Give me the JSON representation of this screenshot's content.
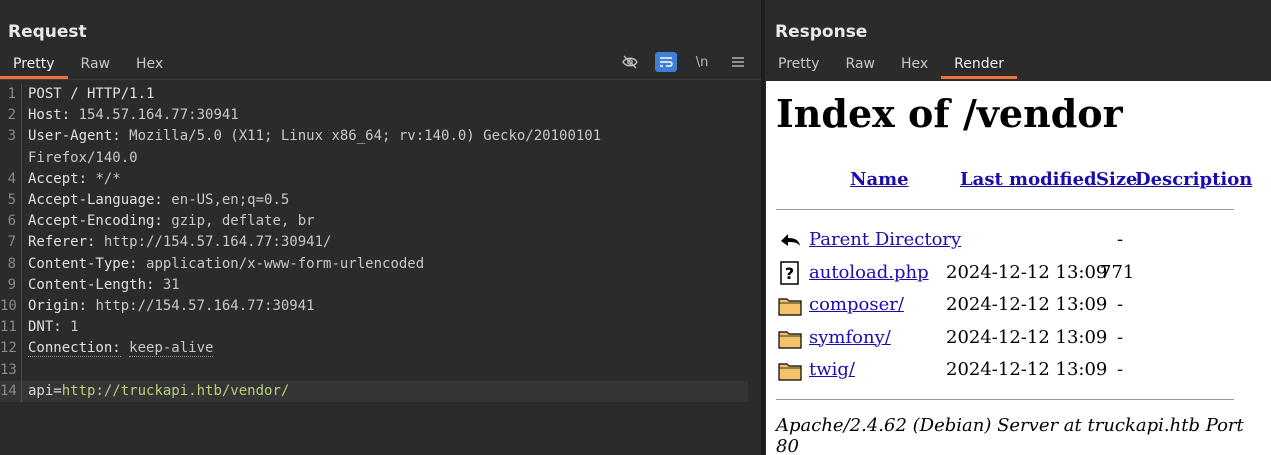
{
  "request": {
    "title": "Request",
    "tabs": [
      "Pretty",
      "Raw",
      "Hex"
    ],
    "active_tab": 0,
    "toolbar": {
      "hide_icon": "eye-slash-icon",
      "wrap_icon": "wrap-lines-icon",
      "newline_label": "\\n",
      "menu_icon": "hamburger-menu-icon"
    },
    "lines": [
      {
        "n": "1",
        "parts": [
          {
            "t": "POST / HTTP/1.1",
            "c": "hdr-name"
          }
        ]
      },
      {
        "n": "2",
        "parts": [
          {
            "t": "Host: ",
            "c": "hdr-name"
          },
          {
            "t": "154.57.164.77:30941",
            "c": "hdr-val"
          }
        ]
      },
      {
        "n": "3",
        "parts": [
          {
            "t": "User-Agent: ",
            "c": "hdr-name"
          },
          {
            "t": "Mozilla/5.0 (X11; Linux x86_64; rv:140.0) Gecko/20100101",
            "c": "hdr-val"
          }
        ]
      },
      {
        "n": "",
        "parts": [
          {
            "t": "Firefox/140.0",
            "c": "hdr-val"
          }
        ]
      },
      {
        "n": "4",
        "parts": [
          {
            "t": "Accept: ",
            "c": "hdr-name"
          },
          {
            "t": "*/*",
            "c": "hdr-val"
          }
        ]
      },
      {
        "n": "5",
        "parts": [
          {
            "t": "Accept-Language: ",
            "c": "hdr-name"
          },
          {
            "t": "en-US,en;q=0.5",
            "c": "hdr-val"
          }
        ]
      },
      {
        "n": "6",
        "parts": [
          {
            "t": "Accept-Encoding: ",
            "c": "hdr-name"
          },
          {
            "t": "gzip, deflate, br",
            "c": "hdr-val"
          }
        ]
      },
      {
        "n": "7",
        "parts": [
          {
            "t": "Referer: ",
            "c": "hdr-name"
          },
          {
            "t": "http://154.57.164.77:30941/",
            "c": "hdr-val"
          }
        ]
      },
      {
        "n": "8",
        "parts": [
          {
            "t": "Content-Type: ",
            "c": "hdr-name"
          },
          {
            "t": "application/x-www-form-urlencoded",
            "c": "hdr-val"
          }
        ]
      },
      {
        "n": "9",
        "parts": [
          {
            "t": "Content-Length: ",
            "c": "hdr-name"
          },
          {
            "t": "31",
            "c": "hdr-val"
          }
        ]
      },
      {
        "n": "10",
        "parts": [
          {
            "t": "Origin: ",
            "c": "hdr-name"
          },
          {
            "t": "http://154.57.164.77:30941",
            "c": "hdr-val"
          }
        ]
      },
      {
        "n": "11",
        "parts": [
          {
            "t": "DNT: ",
            "c": "hdr-name"
          },
          {
            "t": "1",
            "c": "hdr-val"
          }
        ]
      },
      {
        "n": "12",
        "parts": [
          {
            "t": "Connection:",
            "c": "hdr-name dotted"
          },
          {
            "t": " ",
            "c": "hdr-val"
          },
          {
            "t": "keep-alive",
            "c": "hdr-val dotted"
          }
        ]
      },
      {
        "n": "13",
        "parts": []
      },
      {
        "n": "14",
        "highlight": true,
        "parts": [
          {
            "t": "api",
            "c": "param-key"
          },
          {
            "t": "=",
            "c": "param-eq"
          },
          {
            "t": "http://truckapi.htb/vendor/",
            "c": "param-val"
          }
        ]
      }
    ]
  },
  "response": {
    "title": "Response",
    "tabs": [
      "Pretty",
      "Raw",
      "Hex",
      "Render"
    ],
    "active_tab": 3,
    "render": {
      "heading": "Index of /vendor",
      "columns": {
        "name": "Name",
        "last_modified": "Last modified",
        "size": "Size",
        "description": "Description"
      },
      "rows": [
        {
          "icon": "back-arrow-icon",
          "name": "Parent Directory",
          "date": "",
          "size": "-"
        },
        {
          "icon": "unknown-file-icon",
          "name": "autoload.php",
          "date": "2024-12-12 13:09",
          "size": "771"
        },
        {
          "icon": "folder-icon",
          "name": "composer/",
          "date": "2024-12-12 13:09",
          "size": "-"
        },
        {
          "icon": "folder-icon",
          "name": "symfony/",
          "date": "2024-12-12 13:09",
          "size": "-"
        },
        {
          "icon": "folder-icon",
          "name": "twig/",
          "date": "2024-12-12 13:09",
          "size": "-"
        }
      ],
      "footer": "Apache/2.4.62 (Debian) Server at truckapi.htb Port 80"
    }
  }
}
